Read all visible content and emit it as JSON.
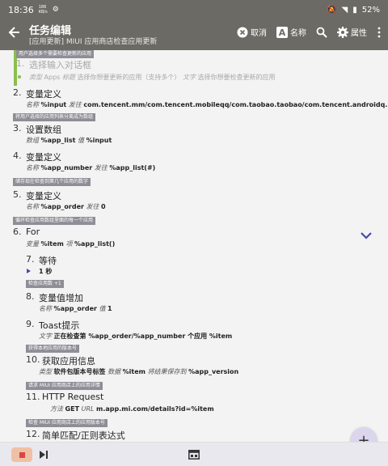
{
  "statusbar": {
    "time": "18:36",
    "net": "186\nKB/s",
    "battery": "52%"
  },
  "appbar": {
    "title": "任务编辑",
    "subtitle": "[应用更新] MIUI 应用商店检查应用更新",
    "cancel_label": "取消",
    "name_label": "名称",
    "props_label": "属性"
  },
  "tasks": [
    {
      "banner": "用户选择多个需要检查更新的应用",
      "num": "1.",
      "title": "选择输入对话框",
      "params": [
        [
          "类型",
          "Apps"
        ],
        [
          "标题",
          "选择你想要更新的应用（支持多个）"
        ],
        [
          "文字",
          "选择你想要检查更新的应用"
        ]
      ]
    },
    {
      "num": "2.",
      "title": "变量定义",
      "params": [
        [
          "名称",
          "%input"
        ],
        [
          "发往",
          "com.tencent.mm/com.tencent.mobileqq/com.taobao.taobao/com.tencent.androidq..."
        ]
      ]
    },
    {
      "banner": "将用户选择的应用列表分离成为数组",
      "num": "3.",
      "title": "设置数组",
      "params": [
        [
          "数组",
          "%app_list"
        ],
        [
          "值",
          "%input"
        ]
      ]
    },
    {
      "num": "4.",
      "title": "变量定义",
      "params": [
        [
          "名称",
          "%app_number"
        ],
        [
          "发往",
          "%app_list(#)"
        ]
      ]
    },
    {
      "banner": "储存现在检查到第几个应用的数字",
      "num": "5.",
      "title": "变量定义",
      "params": [
        [
          "名称",
          "%app_order"
        ],
        [
          "发往",
          "0"
        ]
      ]
    },
    {
      "banner": "循环检查应用数组里面的每一个应用",
      "num": "6.",
      "title": "For",
      "params": [
        [
          "变量",
          "%item"
        ],
        [
          "项",
          "%app_list()"
        ]
      ]
    },
    {
      "num": "7.",
      "title": "等待",
      "params": [
        [
          "",
          "1 秒"
        ]
      ]
    },
    {
      "banner": "检查应用数 +1",
      "num": "8.",
      "title": "变量值增加",
      "params": [
        [
          "名称",
          "%app_order"
        ],
        [
          "值",
          "1"
        ]
      ]
    },
    {
      "num": "9.",
      "title": "Toast提示",
      "params": [
        [
          "文字",
          "正在检查第 %app_order/%app_number 个应用 %item"
        ]
      ]
    },
    {
      "banner": "获得本地应用的版本号",
      "num": "10.",
      "title": "获取应用信息",
      "params": [
        [
          "类型",
          "软件包版本号标签"
        ],
        [
          "数据",
          "%item"
        ],
        [
          "将结果保存到",
          "%app_version"
        ]
      ]
    },
    {
      "banner": "请求 MIUI 应用商店上的应用详情",
      "num": "11.",
      "title": "HTTP Request",
      "params": [
        [
          "方法",
          "GET"
        ],
        [
          "URL",
          "m.app.mi.com/details?id=%item"
        ]
      ]
    },
    {
      "banner": "检查 MIUI 应用商店上的应用版本号",
      "num": "12.",
      "title": "简单匹配/正则表达式",
      "params": []
    }
  ],
  "fab": "+"
}
